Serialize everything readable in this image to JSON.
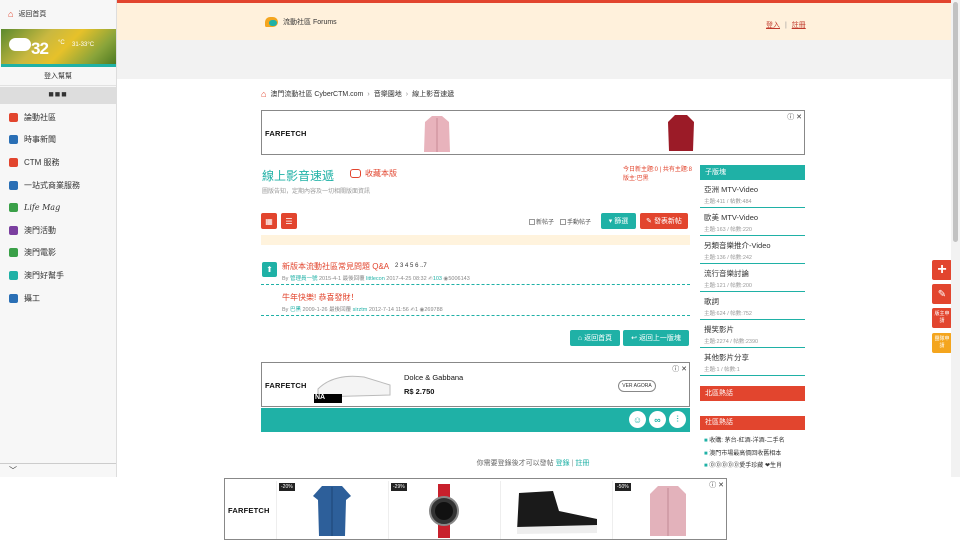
{
  "sidebar": {
    "home_label": "返回首頁",
    "weather": {
      "temp": "32",
      "unit": "°C",
      "range": "31-33°C"
    },
    "login_label": "登入幫幫",
    "more_label": "■■■",
    "items": [
      {
        "label": "論動社區",
        "icon": "home-icon",
        "color": "#e2452e"
      },
      {
        "label": "時事新聞",
        "icon": "globe-icon",
        "color": "#2a6fb5"
      },
      {
        "label": "CTM 服務",
        "icon": "pulse-icon",
        "color": "#e2452e"
      },
      {
        "label": "一站式商業服務",
        "icon": "chart-icon",
        "color": "#2a6fb5"
      },
      {
        "label": "Life Mag",
        "icon": "leaf-icon",
        "color": "#3aa048"
      },
      {
        "label": "澳門活動",
        "icon": "calendar-icon",
        "color": "#7b3fa0"
      },
      {
        "label": "澳門電影",
        "icon": "film-icon",
        "color": "#3aa048"
      },
      {
        "label": "澳門好幫手",
        "icon": "helper-icon",
        "color": "#1fb1a6"
      },
      {
        "label": "攝工",
        "icon": "work-icon",
        "color": "#2a6fb5"
      }
    ],
    "collapse_glyph": "﹀"
  },
  "header": {
    "logo_text": "流動社區 Forums",
    "login": "登入",
    "sep": "|",
    "register": "註冊"
  },
  "breadcrumb": [
    "澳門流動社區 CyberCTM.com",
    "音樂園地",
    "線上影音速遞"
  ],
  "ads": {
    "brand": "FARFETCH",
    "close": "ⓘ ✕",
    "mid_product": "Dolce & Gabbana",
    "mid_price": "R$ 2.750",
    "mid_cta": "VER AGORA",
    "mid_shoe_label": "NA",
    "discounts": [
      "-20%",
      "-29%",
      "",
      "-50%"
    ]
  },
  "forum": {
    "title": "線上影音速遞",
    "favorite": "收藏本版",
    "description": "圖版告知，定期內容及一切相關版面資訊",
    "stats_line1": "今日新主題:0 | 共有主題:8",
    "stats_line2": "版主:巴黑",
    "filter_new": "新帖子",
    "filter_mobile": "手動帖子",
    "btn_filter": "篩選",
    "btn_newpost": "發表新帖"
  },
  "threads": [
    {
      "title": "新版本流動社區常見問題 Q&A",
      "pages": [
        "2",
        "3",
        "4",
        "5",
        "6",
        "..7"
      ],
      "author": "管理員一號",
      "date": "2015-4-1",
      "last_label": "最後回覆",
      "last_user": "littlecon",
      "last_date": "2017-4-25 08:32",
      "replies": "103",
      "views": "5006143"
    },
    {
      "title": "牛年快樂! 恭喜發財！",
      "pages": [],
      "author": "巴黑",
      "date": "2009-1-26",
      "last_label": "最後回覆",
      "last_user": "sirztm",
      "last_date": "2012-7-14 11:56",
      "replies": "1",
      "views": "269788"
    }
  ],
  "buttons": {
    "back_home": "返回首頁",
    "back_list": "返回上一版塊"
  },
  "login_note": {
    "text": "你需要登錄後才可以發帖",
    "login": "登錄",
    "sep": "|",
    "register": "註冊"
  },
  "subforums": {
    "title": "子版塊",
    "items": [
      {
        "name": "亞洲 MTV-Video",
        "stats": "主題:411 / 帖數:484"
      },
      {
        "name": "歐美 MTV-Video",
        "stats": "主題:163 / 帖數:220"
      },
      {
        "name": "另類音樂推介-Video",
        "stats": "主題:136 / 帖數:242"
      },
      {
        "name": "流行音樂討論",
        "stats": "主題:121 / 帖數:200"
      },
      {
        "name": "歌詞",
        "stats": "主題:624 / 帖數:752"
      },
      {
        "name": "攪笑影片",
        "stats": "主題:2274 / 帖數:2390"
      },
      {
        "name": "其他影片分享",
        "stats": "主題:1 / 帖數:1"
      }
    ]
  },
  "hot": {
    "title1": "北區熱話",
    "title2": "社區熱話",
    "items": [
      "收購: 茅台-紅酒-洋酒-二手名",
      "澳門市場最高價回收舊相本",
      "⓪⓪⓪⓪⓪愛手珍藏 ❤生肖"
    ]
  },
  "floating": {
    "mod_apply": "版主申請",
    "group_apply": "團隊申請"
  }
}
